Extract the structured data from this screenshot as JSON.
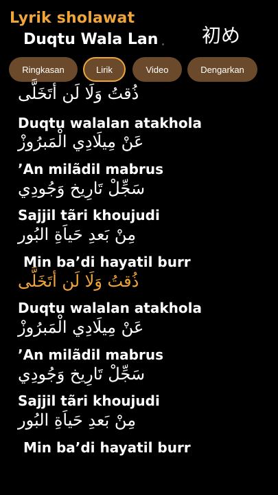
{
  "header": {
    "app_title": "Lyrik sholawat",
    "song_title": "Duqtu Wala Lan",
    "corner_tag": "初め"
  },
  "tabs": [
    {
      "label": "Ringkasan",
      "active": false
    },
    {
      "label": "Lirik",
      "active": true
    },
    {
      "label": "Video",
      "active": false
    },
    {
      "label": "Dengarkan",
      "active": false
    }
  ],
  "colors": {
    "accent": "#f0a53a",
    "tab_background": "#6b4a2c",
    "background": "#000000",
    "text": "#ffffff"
  },
  "lyrics": [
    {
      "text": "ذُقتُ وَلَا لَن أتَخَلَّى",
      "script": "arabic",
      "highlight": false
    },
    {
      "text": "Duqtu walalan atakhola",
      "script": "latin",
      "highlight": false
    },
    {
      "text": "عَنْ مِيلَادِي الْمَبرُوزْ",
      "script": "arabic",
      "highlight": false
    },
    {
      "text": "’An milãdil mabrus",
      "script": "latin",
      "highlight": false
    },
    {
      "text": "سَجِّلْ تَارِيخ وَجُودِي",
      "script": "arabic",
      "highlight": false
    },
    {
      "text": "Sajjil tãri khoujudi",
      "script": "latin",
      "highlight": false
    },
    {
      "text": "مِنْ بَعدِ حَياَةِ البُور",
      "script": "arabic",
      "highlight": false
    },
    {
      "text": "Min ba’di hayatil burr",
      "script": "latin",
      "highlight": false
    },
    {
      "text": "ذُقتُ وَلَا لَن أتَخَلَّى",
      "script": "arabic",
      "highlight": true
    },
    {
      "text": "Duqtu walalan atakhola",
      "script": "latin",
      "highlight": false
    },
    {
      "text": "عَنْ مِيلَادِي الْمَبرُوزْ",
      "script": "arabic",
      "highlight": false
    },
    {
      "text": "’An milãdil mabrus",
      "script": "latin",
      "highlight": false
    },
    {
      "text": "سَجِّلْ تَارِيخ وَجُودِي",
      "script": "arabic",
      "highlight": false
    },
    {
      "text": "Sajjil tãri khoujudi",
      "script": "latin",
      "highlight": false
    },
    {
      "text": "مِنْ بَعدِ حَياَةِ البُور",
      "script": "arabic",
      "highlight": false
    },
    {
      "text": "Min ba’di hayatil burr",
      "script": "latin",
      "highlight": false
    }
  ]
}
